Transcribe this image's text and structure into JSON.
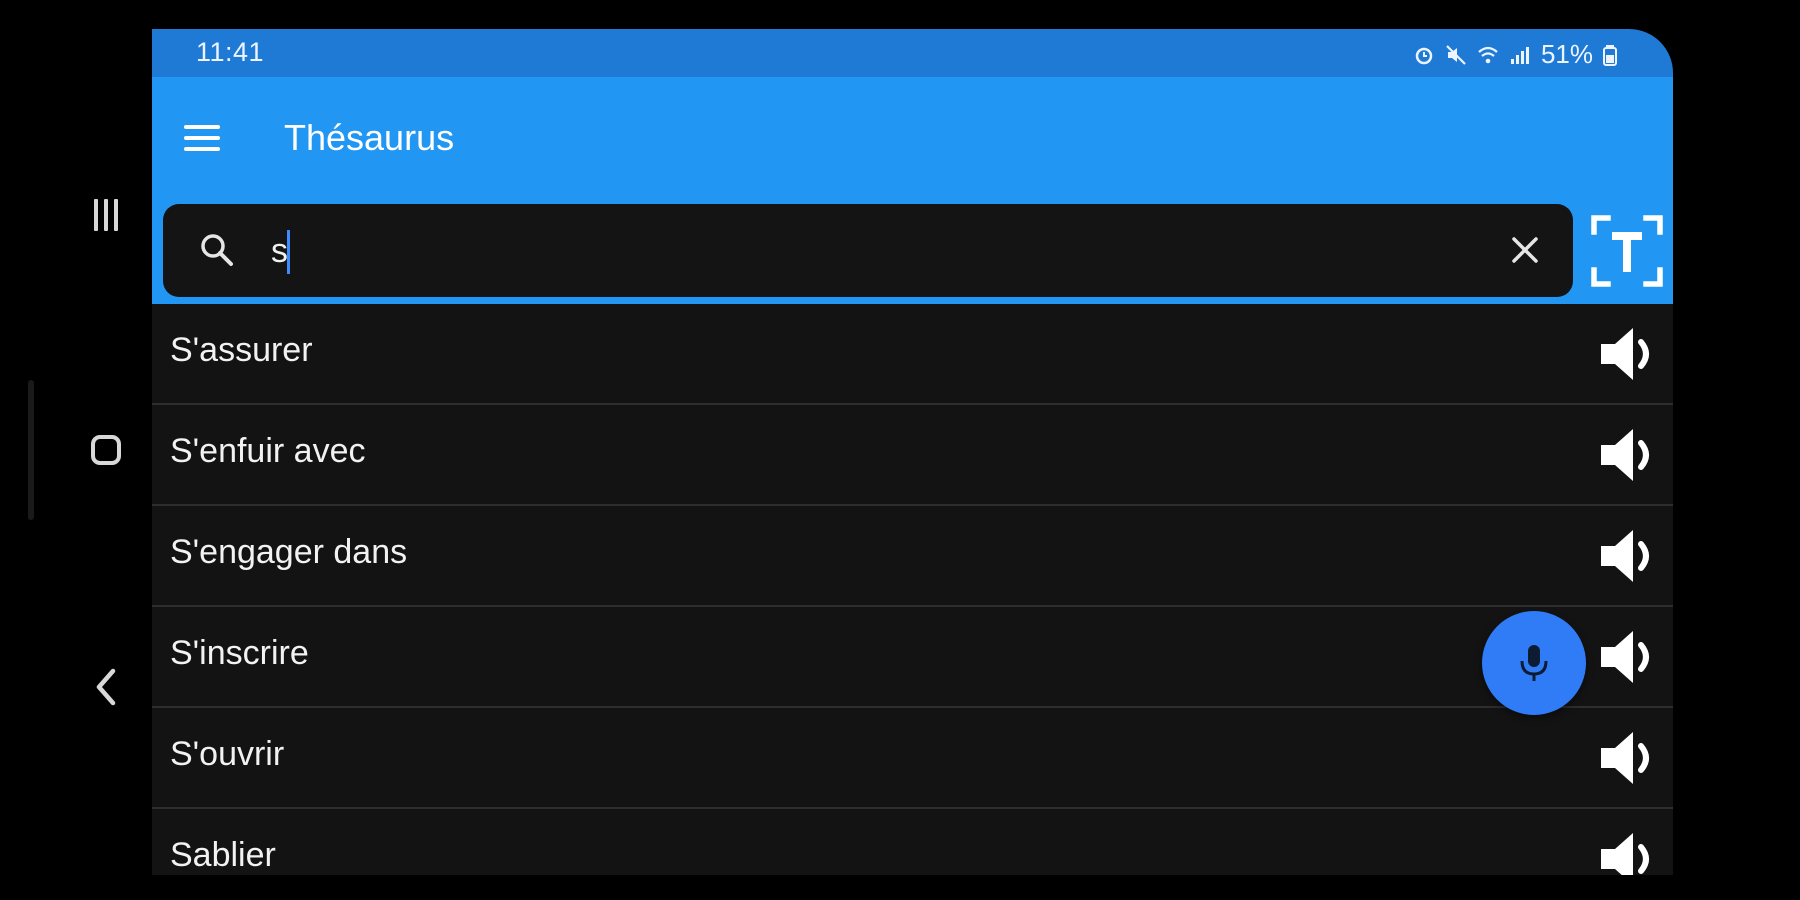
{
  "status_bar": {
    "time": "11:41",
    "battery": "51%",
    "icons": [
      "alarm-icon",
      "mute-icon",
      "wifi-icon",
      "signal-icon",
      "battery-icon"
    ]
  },
  "app_bar": {
    "title": "Thésaurus",
    "menu_icon": "hamburger-menu-icon"
  },
  "search": {
    "value": "s",
    "search_icon": "search-icon",
    "clear_icon": "close-icon"
  },
  "ocr_button": {
    "icon": "text-scan-icon"
  },
  "results": [
    {
      "label": "S'assurer"
    },
    {
      "label": "S'enfuir avec"
    },
    {
      "label": "S'engager dans"
    },
    {
      "label": "S'inscrire"
    },
    {
      "label": "S'ouvrir"
    },
    {
      "label": "Sablier"
    }
  ],
  "fab": {
    "icon": "microphone-icon"
  },
  "system_nav": {
    "recents_icon": "recents-icon",
    "home_icon": "home-icon",
    "back_icon": "back-icon"
  },
  "colors": {
    "status_bar": "#1f7ad6",
    "app_bar": "#2196f3",
    "list_background": "#131313",
    "fab": "#2f7cf6",
    "caret": "#3d8bff"
  }
}
